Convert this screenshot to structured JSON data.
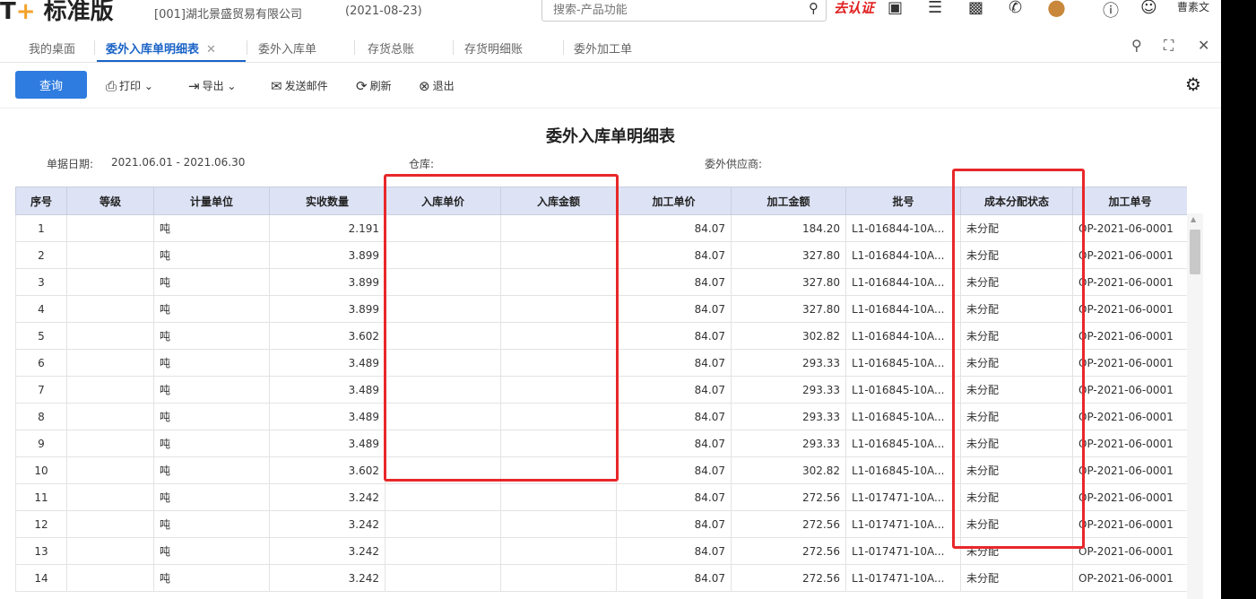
{
  "app": {
    "logo_main": "T",
    "logo_plus": "+",
    "logo_text": "标准版",
    "company": "[001]湖北景盛贸易有限公司",
    "date": "(2021-08-23)",
    "auth_label": "去认证",
    "username": "曹素文"
  },
  "search": {
    "placeholder": "搜索-产品功能"
  },
  "tabs": [
    {
      "label": "我的桌面"
    },
    {
      "label": "委外入库单明细表",
      "active": true
    },
    {
      "label": "委外入库单"
    },
    {
      "label": "存货总账"
    },
    {
      "label": "存货明细账"
    },
    {
      "label": "委外加工单"
    }
  ],
  "toolbar": {
    "query": "查询",
    "print": "打印",
    "export": "导出",
    "email": "发送邮件",
    "refresh": "刷新",
    "exit": "退出"
  },
  "report": {
    "title": "委外入库单明细表",
    "date_label": "单据日期:",
    "date_value": "2021.06.01 - 2021.06.30",
    "warehouse_label": "仓库:",
    "supplier_label": "委外供应商:"
  },
  "table": {
    "headers": [
      "序号",
      "等级",
      "计量单位",
      "实收数量",
      "入库单价",
      "入库金额",
      "加工单价",
      "加工金额",
      "批号",
      "成本分配状态",
      "加工单号"
    ],
    "rows": [
      [
        "1",
        "",
        "吨",
        "2.191",
        "",
        "",
        "84.07",
        "184.20",
        "L1-016844-10A...",
        "未分配",
        "OP-2021-06-0001"
      ],
      [
        "2",
        "",
        "吨",
        "3.899",
        "",
        "",
        "84.07",
        "327.80",
        "L1-016844-10A...",
        "未分配",
        "OP-2021-06-0001"
      ],
      [
        "3",
        "",
        "吨",
        "3.899",
        "",
        "",
        "84.07",
        "327.80",
        "L1-016844-10A...",
        "未分配",
        "OP-2021-06-0001"
      ],
      [
        "4",
        "",
        "吨",
        "3.899",
        "",
        "",
        "84.07",
        "327.80",
        "L1-016844-10A...",
        "未分配",
        "OP-2021-06-0001"
      ],
      [
        "5",
        "",
        "吨",
        "3.602",
        "",
        "",
        "84.07",
        "302.82",
        "L1-016844-10A...",
        "未分配",
        "OP-2021-06-0001"
      ],
      [
        "6",
        "",
        "吨",
        "3.489",
        "",
        "",
        "84.07",
        "293.33",
        "L1-016845-10A...",
        "未分配",
        "OP-2021-06-0001"
      ],
      [
        "7",
        "",
        "吨",
        "3.489",
        "",
        "",
        "84.07",
        "293.33",
        "L1-016845-10A...",
        "未分配",
        "OP-2021-06-0001"
      ],
      [
        "8",
        "",
        "吨",
        "3.489",
        "",
        "",
        "84.07",
        "293.33",
        "L1-016845-10A...",
        "未分配",
        "OP-2021-06-0001"
      ],
      [
        "9",
        "",
        "吨",
        "3.489",
        "",
        "",
        "84.07",
        "293.33",
        "L1-016845-10A...",
        "未分配",
        "OP-2021-06-0001"
      ],
      [
        "10",
        "",
        "吨",
        "3.602",
        "",
        "",
        "84.07",
        "302.82",
        "L1-016845-10A...",
        "未分配",
        "OP-2021-06-0001"
      ],
      [
        "11",
        "",
        "吨",
        "3.242",
        "",
        "",
        "84.07",
        "272.56",
        "L1-017471-10A...",
        "未分配",
        "OP-2021-06-0001"
      ],
      [
        "12",
        "",
        "吨",
        "3.242",
        "",
        "",
        "84.07",
        "272.56",
        "L1-017471-10A...",
        "未分配",
        "OP-2021-06-0001"
      ],
      [
        "13",
        "",
        "吨",
        "3.242",
        "",
        "",
        "84.07",
        "272.56",
        "L1-017471-10A...",
        "未分配",
        "OP-2021-06-0001"
      ],
      [
        "14",
        "",
        "吨",
        "3.242",
        "",
        "",
        "84.07",
        "272.56",
        "L1-017471-10A...",
        "未分配",
        "OP-2021-06-0001"
      ]
    ]
  },
  "colors": {
    "accent": "#2f7ce0",
    "header_bg": "#dde3f5",
    "highlight": "#e8272a"
  }
}
